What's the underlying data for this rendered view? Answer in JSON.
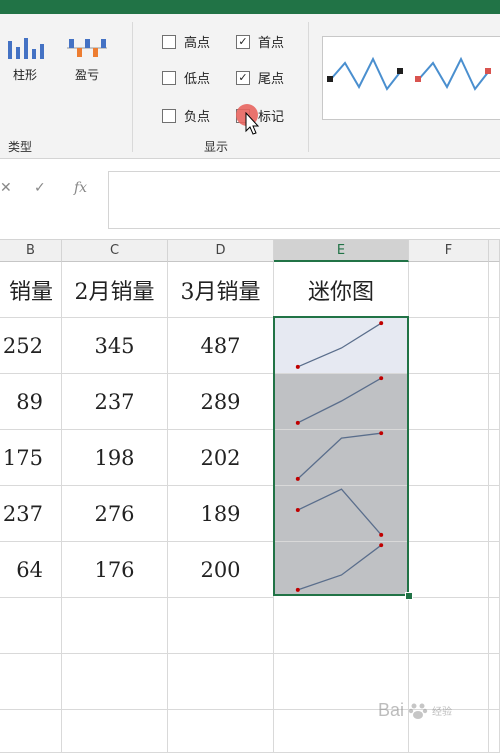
{
  "ribbon": {
    "type_group": {
      "label": "类型",
      "column_button": "柱形",
      "winloss_button": "盈亏"
    },
    "show_group": {
      "label": "显示",
      "options": [
        {
          "label": "高点",
          "checked": false
        },
        {
          "label": "低点",
          "checked": false
        },
        {
          "label": "负点",
          "checked": false
        },
        {
          "label": "首点",
          "checked": true
        },
        {
          "label": "尾点",
          "checked": true
        },
        {
          "label": "标记",
          "checked": false
        }
      ]
    },
    "style_preview_colors": {
      "line": "#4a8fcf",
      "marker_dark": "#1f1f1f",
      "marker_red": "#d9534f"
    }
  },
  "formula_bar": {
    "cancel_symbol": "✕",
    "enter_symbol": "✓",
    "fx_label": "fx",
    "value": ""
  },
  "columns": [
    "B",
    "C",
    "D",
    "E",
    "F"
  ],
  "header_row": [
    "销量",
    "2月销量",
    "3月销量",
    "迷你图"
  ],
  "rows": [
    {
      "b": "252",
      "c": "345",
      "d": "487"
    },
    {
      "b": "89",
      "c": "237",
      "d": "289"
    },
    {
      "b": "175",
      "c": "198",
      "d": "202"
    },
    {
      "b": "237",
      "c": "276",
      "d": "189"
    },
    {
      "b": "64",
      "c": "176",
      "d": "200"
    }
  ],
  "sparkline_colors": {
    "line": "#5a6e8c",
    "marker": "#c00000"
  },
  "watermark": {
    "text": "Bai",
    "sub": "经验"
  }
}
